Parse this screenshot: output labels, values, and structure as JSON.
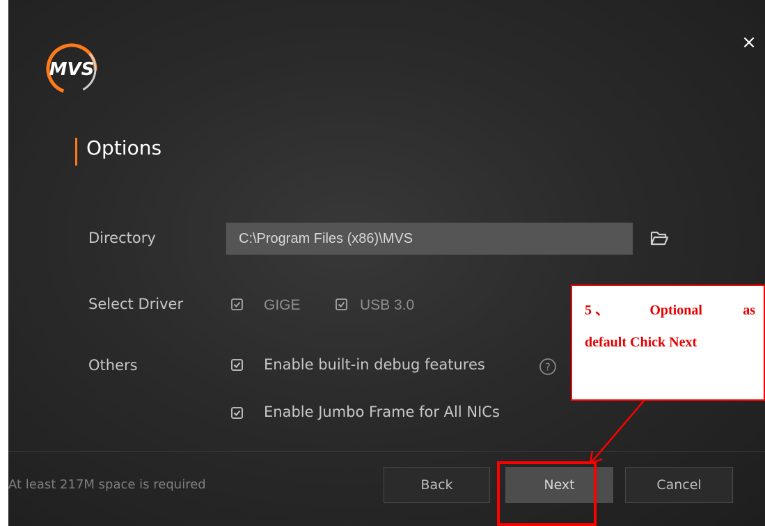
{
  "window": {
    "close_glyph": "×",
    "logo_text": "MVS"
  },
  "header": {
    "title": "Options",
    "accent_color": "#ff7a1a"
  },
  "directory": {
    "label": "Directory",
    "value": "C:\\Program Files (x86)\\MVS",
    "browse_icon": "folder-open-icon"
  },
  "driver": {
    "label": "Select Driver",
    "options": [
      {
        "label": "GIGE",
        "checked": true
      },
      {
        "label": "USB 3.0",
        "checked": true
      }
    ]
  },
  "others": {
    "label": "Others",
    "options": [
      {
        "label": "Enable built-in debug features",
        "checked": true,
        "help_icon": "question-circle-icon"
      },
      {
        "label": "Enable Jumbo Frame for All NICs",
        "checked": true
      }
    ]
  },
  "footer": {
    "space_note": "At least 217M space is required",
    "back_label": "Back",
    "next_label": "Next",
    "cancel_label": "Cancel"
  },
  "annotation": {
    "line1_left": "5 、",
    "line1_mid": "Optional",
    "line1_right": "as",
    "line2": "default Chick Next",
    "color": "#ff0000"
  }
}
